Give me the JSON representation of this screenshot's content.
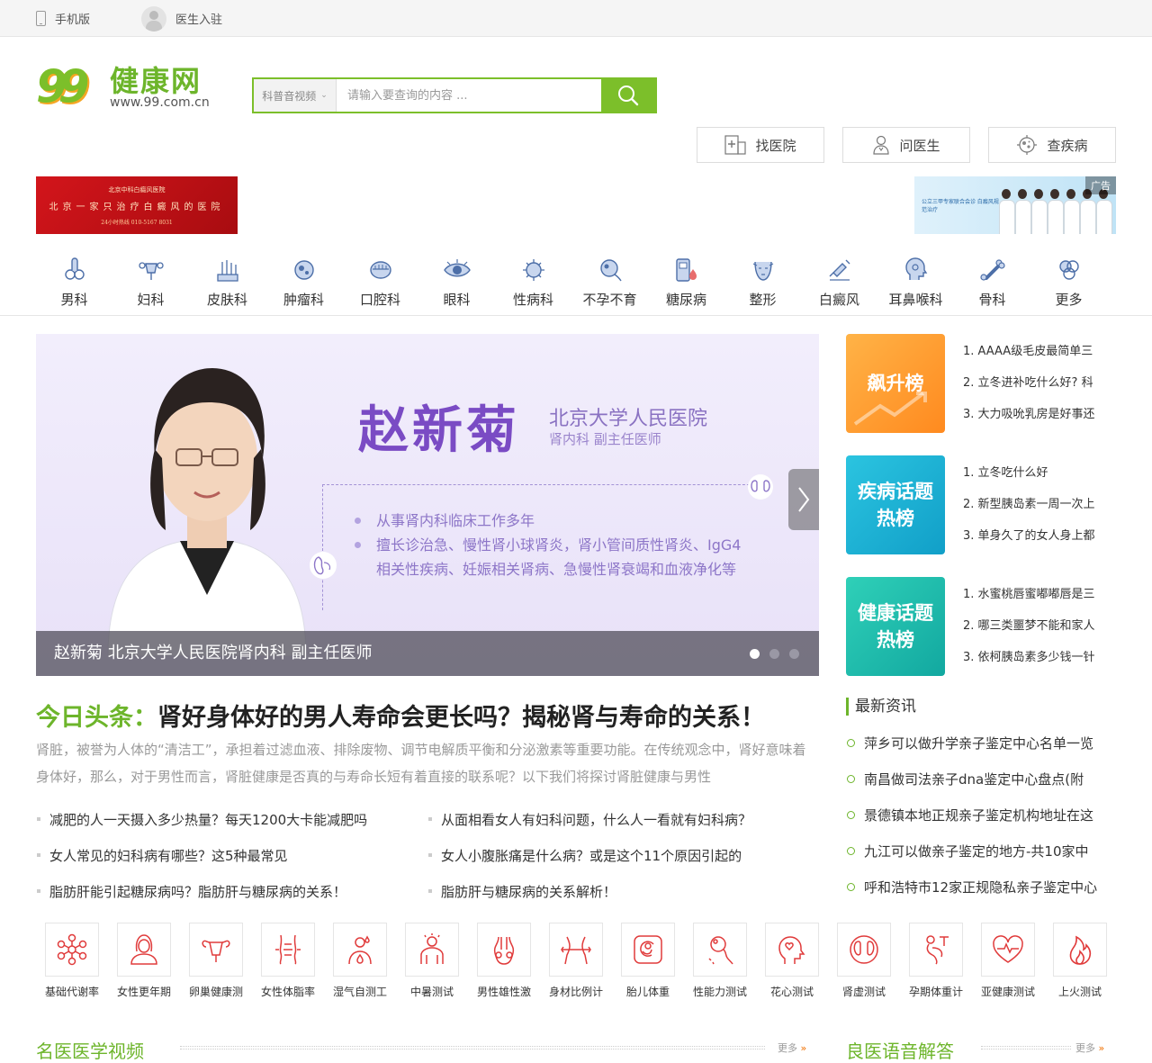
{
  "topbar": {
    "mobile": "手机版",
    "doctor_join": "医生入驻"
  },
  "logo": {
    "number": "99",
    "name": "健康网",
    "domain": "www.99.com.cn"
  },
  "search": {
    "category": "科普音视频",
    "placeholder": "请输入要查询的内容 ..."
  },
  "quick": [
    {
      "label": "找医院",
      "icon": "hospital-plus-icon"
    },
    {
      "label": "问医生",
      "icon": "doctor-icon"
    },
    {
      "label": "查疾病",
      "icon": "virus-icon"
    }
  ],
  "ads": {
    "left": {
      "line1": "北京中科白癜风医院",
      "line2": "北京一家只治疗白癜风的医院",
      "line3": "24小时热线 010-5167 8031"
    },
    "right": {
      "tag": "广告",
      "text": "公立三甲专家联合会诊 白癜风规范治疗"
    }
  },
  "departments": [
    {
      "label": "男科",
      "icon": "male-organ-icon"
    },
    {
      "label": "妇科",
      "icon": "uterus-icon"
    },
    {
      "label": "皮肤科",
      "icon": "skin-icon"
    },
    {
      "label": "肿瘤科",
      "icon": "tumor-cell-icon"
    },
    {
      "label": "口腔科",
      "icon": "mouth-icon"
    },
    {
      "label": "眼科",
      "icon": "eye-icon"
    },
    {
      "label": "性病科",
      "icon": "virus-icon"
    },
    {
      "label": "不孕不育",
      "icon": "sperm-egg-icon"
    },
    {
      "label": "糖尿病",
      "icon": "glucose-meter-icon"
    },
    {
      "label": "整形",
      "icon": "face-icon"
    },
    {
      "label": "白癜风",
      "icon": "syringe-icon"
    },
    {
      "label": "耳鼻喉科",
      "icon": "ent-head-icon"
    },
    {
      "label": "骨科",
      "icon": "bone-icon"
    },
    {
      "label": "更多",
      "icon": "more-icon"
    }
  ],
  "banner": {
    "name": "赵新菊",
    "hospital": "北京大学人民医院",
    "dept": "肾内科  副主任医师",
    "bullet1": "从事肾内科临床工作多年",
    "bullet2": "擅长诊治急、慢性肾小球肾炎，肾小管间质性肾炎、IgG4",
    "bullet3": "相关性疾病、妊娠相关肾病、急慢性肾衰竭和血液净化等",
    "caption": "赵新菊 北京大学人民医院肾内科 副主任医师"
  },
  "rankings": [
    {
      "tile": "飙升榜",
      "color_from": "#ffb347",
      "color_to": "#ff8a1f",
      "items": [
        "1. AAAA级毛皮最简单三",
        "2. 立冬进补吃什么好? 科",
        "3. 大力吸吮乳房是好事还"
      ]
    },
    {
      "tile": "疾病话题热榜",
      "color_from": "#2bc4e0",
      "color_to": "#119fc8",
      "items": [
        "1. 立冬吃什么好",
        "2. 新型胰岛素一周一次上",
        "3. 单身久了的女人身上都"
      ]
    },
    {
      "tile": "健康话题热榜",
      "color_from": "#2fd0b8",
      "color_to": "#12a8a0",
      "items": [
        "1. 水蜜桃唇蜜嘟嘟唇是三",
        "2. 哪三类噩梦不能和家人",
        "3. 依柯胰岛素多少钱一针"
      ]
    }
  ],
  "headline": {
    "lead": "今日头条：",
    "title": "肾好身体好的男人寿命会更长吗？揭秘肾与寿命的关系！",
    "summary": "肾脏，被誉为人体的“清洁工”，承担着过滤血液、排除废物、调节电解质平衡和分泌激素等重要功能。在传统观念中，肾好意味着身体好，那么，对于男性而言，肾脏健康是否真的与寿命长短有着直接的联系呢？以下我们将探讨肾脏健康与男性"
  },
  "links": [
    "减肥的人一天摄入多少热量？每天1200大卡能减肥吗",
    "从面相看女人有妇科问题，什么人一看就有妇科病？",
    "女人常见的妇科病有哪些？这5种最常见",
    "女人小腹胀痛是什么病？或是这个11个原因引起的",
    "脂肪肝能引起糖尿病吗？脂肪肝与糖尿病的关系！",
    "脂肪肝与糖尿病的关系解析！"
  ],
  "news": {
    "title": "最新资讯",
    "items": [
      "萍乡可以做升学亲子鉴定中心名单一览",
      "南昌做司法亲子dna鉴定中心盘点(附",
      "景德镇本地正规亲子鉴定机构地址在这",
      "九江可以做亲子鉴定的地方-共10家中",
      "呼和浩特市12家正规隐私亲子鉴定中心"
    ]
  },
  "tests": [
    {
      "label": "基础代谢率",
      "icon": "molecule-icon"
    },
    {
      "label": "女性更年期",
      "icon": "woman-icon"
    },
    {
      "label": "卵巢健康测",
      "icon": "ovary-icon"
    },
    {
      "label": "女性体脂率",
      "icon": "body-fat-icon"
    },
    {
      "label": "湿气自测工",
      "icon": "humidity-person-icon"
    },
    {
      "label": "中暑测试",
      "icon": "heatstroke-icon"
    },
    {
      "label": "男性雄性激",
      "icon": "male-hormone-icon"
    },
    {
      "label": "身材比例计",
      "icon": "waist-icon"
    },
    {
      "label": "胎儿体重",
      "icon": "fetus-icon"
    },
    {
      "label": "性能力测试",
      "icon": "sperm-icon"
    },
    {
      "label": "花心测试",
      "icon": "head-heart-icon"
    },
    {
      "label": "肾虚测试",
      "icon": "kidney-icon"
    },
    {
      "label": "孕期体重计",
      "icon": "pregnancy-icon"
    },
    {
      "label": "亚健康测试",
      "icon": "heart-pulse-icon"
    },
    {
      "label": "上火测试",
      "icon": "flame-icon"
    }
  ],
  "sections": {
    "left": "名医医学视频",
    "right": "良医语音解答",
    "more": "更多",
    "more_arrow": "»"
  }
}
